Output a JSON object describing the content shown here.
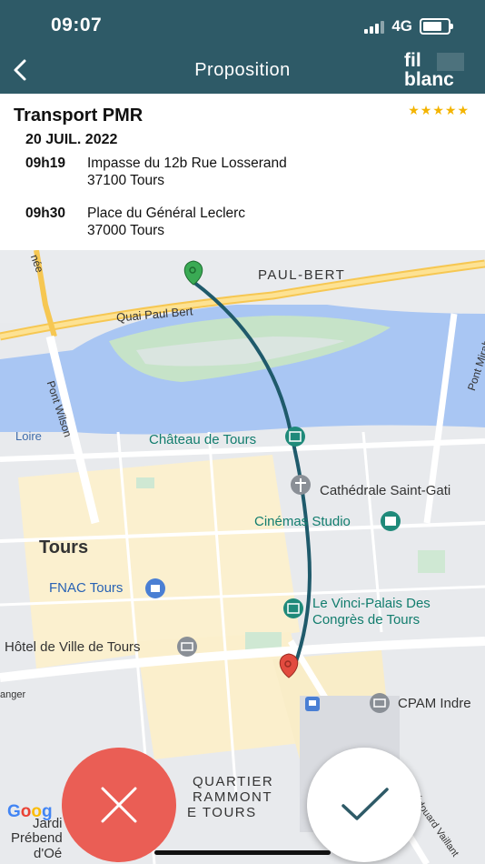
{
  "status_bar": {
    "time": "09:07",
    "network": "4G",
    "battery_percent": 75
  },
  "nav": {
    "title": "Proposition",
    "logo_line1": "fil",
    "logo_line2": "blanc",
    "back_icon": "chevron-left-icon"
  },
  "trip": {
    "title": "Transport PMR",
    "rating": "★★★★★",
    "date": "20 JUIL. 2022",
    "pickup": {
      "time": "09h19",
      "line1": "Impasse du 12b Rue Losserand",
      "line2": "37100 Tours"
    },
    "dropoff": {
      "time": "09h30",
      "line1": "Place du Général Leclerc",
      "line2": "37000 Tours"
    }
  },
  "map": {
    "labels": {
      "paul_bert": "PAUL-BERT",
      "quai_paul_bert": "Quai Paul Bert",
      "pont_wilson": "Pont Wilson",
      "pont_mirabeau": "Pont Mirab",
      "loire": "Loire",
      "chateau": "Château de Tours",
      "cathedrale": "Cathédrale Saint-Gati",
      "cinemas": "Cinémas Studio",
      "tours": "Tours",
      "fnac": "FNAC Tours",
      "vinci_line1": "Le Vinci-Palais Des",
      "vinci_line2": "Congrès de Tours",
      "hotel_de_ville": "Hôtel de Ville de Tours",
      "cpam": "CPAM Indre",
      "quartier_line1": "QUARTIER",
      "quartier_line2": "RAMMONT",
      "quartier_line3": "E TOURS",
      "rue_edouard": "Rue Édouard Vaillant",
      "prebende_line1": "Prébend",
      "prebende_line2": "d'Oé",
      "jardin": "Jardi",
      "edge_nee": "née",
      "edge_anger": "anger",
      "google": "Google"
    },
    "route_color": "#1f5a6b"
  },
  "actions": {
    "cancel_icon": "close-icon",
    "accept_icon": "check-icon"
  }
}
